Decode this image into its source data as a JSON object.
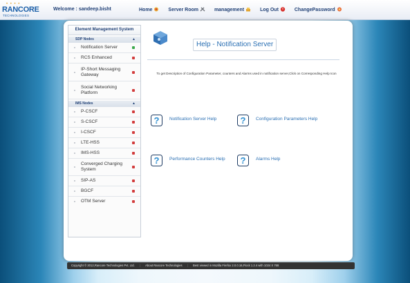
{
  "header": {
    "logo": {
      "name": "RANCORE",
      "subtitle": "TECHNOLOGIES"
    },
    "welcome": "Welcome : sandeep.bisht",
    "nav": [
      {
        "label": "Home",
        "icon": "home-icon"
      },
      {
        "label": "Server Room",
        "icon": "tools-icon"
      },
      {
        "label": "management",
        "icon": "management-icon"
      },
      {
        "label": "Log Out",
        "icon": "logout-icon"
      },
      {
        "label": "ChangePassword",
        "icon": "password-icon"
      }
    ]
  },
  "sidebar": {
    "title": "Element Management System",
    "groups": [
      {
        "label": "SDP Nodes",
        "items": [
          {
            "label": "Notification Server",
            "status": "green"
          },
          {
            "label": "RCS Enhanced",
            "status": "red"
          },
          {
            "label": "IP-Short Messaging Gateway",
            "status": "red"
          },
          {
            "label": "Social Networking Platform",
            "status": "red"
          }
        ]
      },
      {
        "label": "IMS Nodes",
        "items": [
          {
            "label": "P-CSCF",
            "status": "red"
          },
          {
            "label": "S-CSCF",
            "status": "red"
          },
          {
            "label": "I-CSCF",
            "status": "red"
          },
          {
            "label": "LTE-HSS",
            "status": "red"
          },
          {
            "label": "IMS-HSS",
            "status": "red"
          },
          {
            "label": "Converged Charging System",
            "status": "red"
          },
          {
            "label": "SIP-AS",
            "status": "red"
          },
          {
            "label": "BGCF",
            "status": "red"
          },
          {
            "label": "OTM Server",
            "status": "red"
          }
        ]
      }
    ]
  },
  "content": {
    "title": "Help - Notification Server",
    "description": "To get Description of Configuration Parameter, counters and Alarms used in notification server,Click on Corresponding Help Icon",
    "help_links": [
      {
        "label": "Notification Server Help"
      },
      {
        "label": "Configuration Parameters Help"
      },
      {
        "label": "Performance Counters Help"
      },
      {
        "label": "Alarms Help"
      }
    ]
  },
  "footer": {
    "copyright": "Copyright © 2012,Rancore Technologies Pvt. Ltd.",
    "about": "About Rancore Technologies",
    "browser": "Best viewed in Mozilla Firefox 2.0.0.16,Flock 1.2.4 with 1024 X 768"
  },
  "colors": {
    "status_green": "#3aa84a",
    "status_red": "#d23c3c",
    "link": "#2a6fb3",
    "header_text": "#1f3f75"
  }
}
